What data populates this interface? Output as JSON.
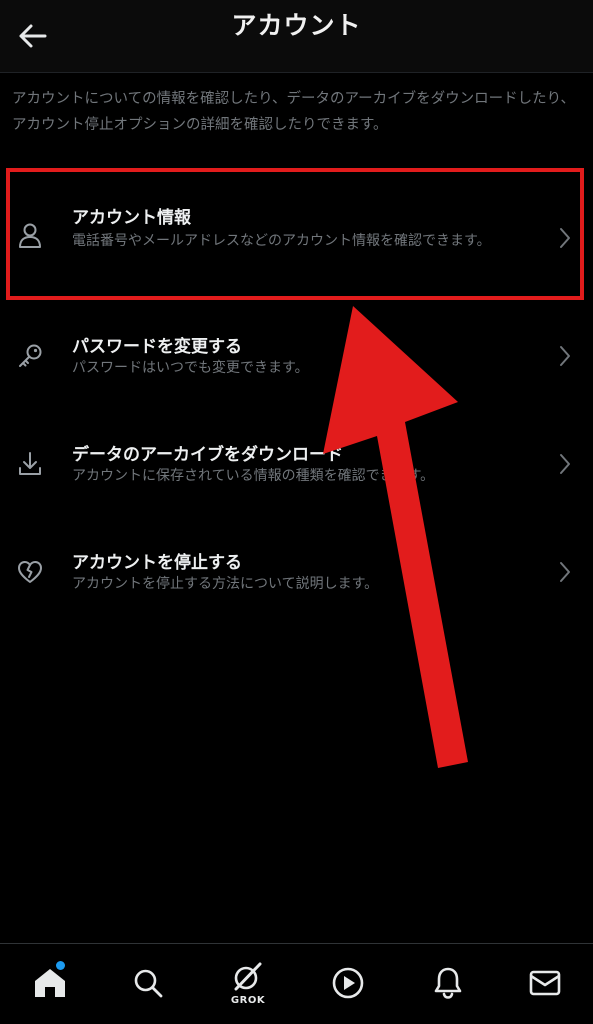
{
  "header": {
    "title": "アカウント"
  },
  "intro": {
    "text": "アカウントについての情報を確認したり、データのアーカイブをダウンロードしたり、アカウント停止オプションの詳細を確認したりできます。"
  },
  "menu": {
    "items": [
      {
        "title": "アカウント情報",
        "description": "電話番号やメールアドレスなどのアカウント情報を確認できます。",
        "icon": "person-icon"
      },
      {
        "title": "パスワードを変更する",
        "description": "パスワードはいつでも変更できます。",
        "icon": "key-icon"
      },
      {
        "title": "データのアーカイブをダウンロード",
        "description": "アカウントに保存されている情報の種類を確認できます。",
        "icon": "download-icon"
      },
      {
        "title": "アカウントを停止する",
        "description": "アカウントを停止する方法について説明します。",
        "icon": "broken-heart-icon"
      }
    ]
  },
  "bottom_nav": {
    "items": [
      {
        "icon": "home-icon"
      },
      {
        "icon": "search-icon"
      },
      {
        "icon": "grok-icon",
        "label": "GROK"
      },
      {
        "icon": "play-icon"
      },
      {
        "icon": "bell-icon"
      },
      {
        "icon": "mail-icon"
      }
    ]
  },
  "colors": {
    "background": "#000000",
    "text_primary": "#e7e9ea",
    "text_secondary": "#71767b",
    "annotation_red": "#e21c1c",
    "notification_blue": "#1d9bf0"
  }
}
